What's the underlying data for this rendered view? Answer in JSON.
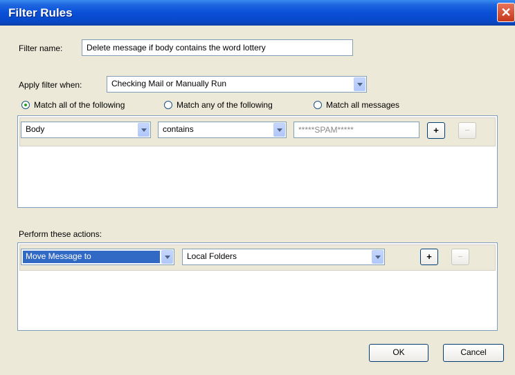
{
  "window": {
    "title": "Filter Rules",
    "close_glyph": "✕"
  },
  "filter_name": {
    "label": "Filter name:",
    "value": "Delete message if body contains the word lottery"
  },
  "apply_filter": {
    "label": "Apply filter when:",
    "selected": "Checking Mail or Manually Run"
  },
  "match_options": [
    {
      "label": "Match all of the following",
      "selected": true
    },
    {
      "label": "Match any of the following",
      "selected": false
    },
    {
      "label": "Match all messages",
      "selected": false
    }
  ],
  "rule": {
    "field": "Body",
    "operator": "contains",
    "value": "*****SPAM*****",
    "add_label": "+",
    "remove_label": "−"
  },
  "actions": {
    "label": "Perform these actions:",
    "action": "Move Message to",
    "target": "Local Folders",
    "add_label": "+",
    "remove_label": "−"
  },
  "buttons": {
    "ok": "OK",
    "cancel": "Cancel"
  }
}
